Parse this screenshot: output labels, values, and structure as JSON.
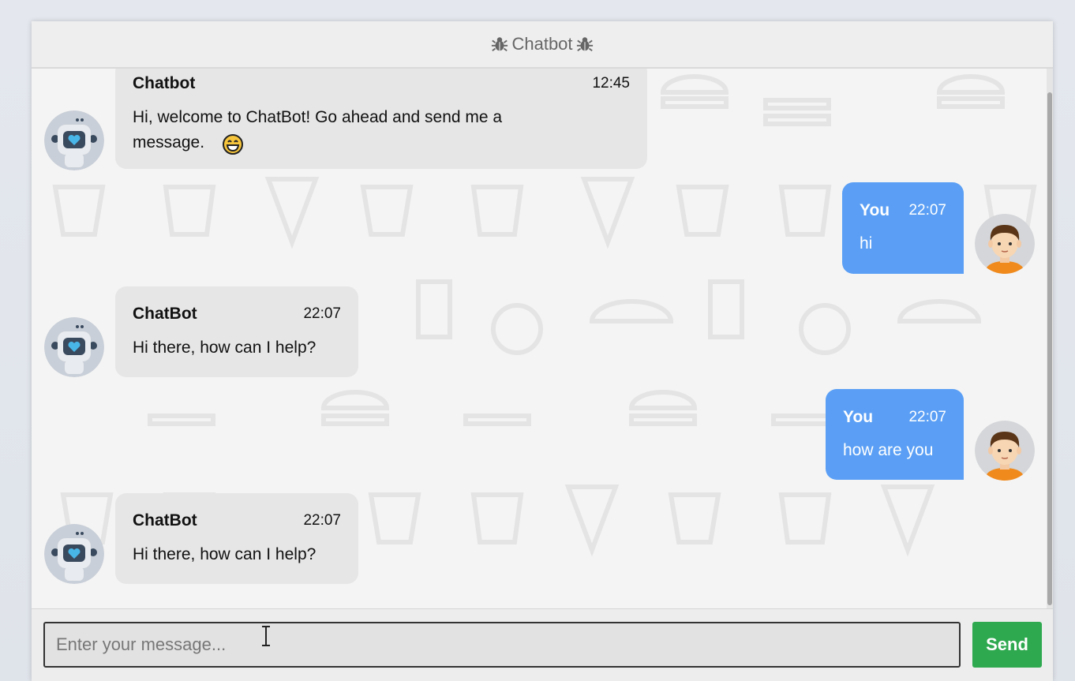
{
  "header": {
    "title": "Chatbot",
    "icon": "bug-icon"
  },
  "messages": [
    {
      "sender": "Chatbot",
      "time": "12:45",
      "text_line1": "Hi, welcome to ChatBot! Go ahead and send me a",
      "text_line2": "message.",
      "emoji": "grinning-face-emoji",
      "type": "bot"
    },
    {
      "sender": "You",
      "time": "22:07",
      "text": "hi",
      "type": "user"
    },
    {
      "sender": "ChatBot",
      "time": "22:07",
      "text": "Hi there, how can I help?",
      "type": "bot"
    },
    {
      "sender": "You",
      "time": "22:07",
      "text": "how are you",
      "type": "user"
    },
    {
      "sender": "ChatBot",
      "time": "22:07",
      "text": "Hi there, how can I help?",
      "type": "bot"
    }
  ],
  "input": {
    "placeholder": "Enter your message...",
    "value": ""
  },
  "send_button": {
    "label": "Send"
  },
  "colors": {
    "user_bubble": "#5a9ff5",
    "bot_bubble": "#e6e6e6",
    "send_button": "#2fa94f"
  }
}
